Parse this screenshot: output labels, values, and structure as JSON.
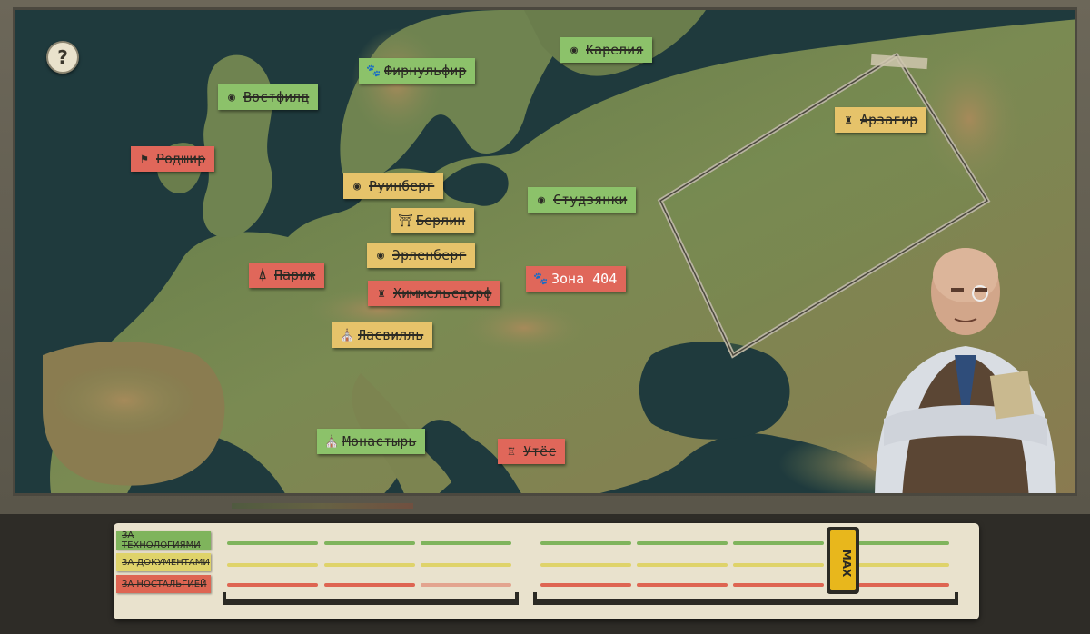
{
  "help_button": {
    "label": "?"
  },
  "cities": [
    {
      "name": "Карелия",
      "color": "green",
      "icon": "target-icon",
      "glyph": "◉",
      "crossed": true
    },
    {
      "name": "Фирнульфир",
      "color": "green",
      "icon": "paw-icon",
      "glyph": "🐾",
      "crossed": true
    },
    {
      "name": "Востфилд",
      "color": "green",
      "icon": "target-icon",
      "glyph": "◉",
      "crossed": true
    },
    {
      "name": "Арзагир",
      "color": "yellow",
      "icon": "castle-icon",
      "glyph": "♜",
      "crossed": true
    },
    {
      "name": "Родшир",
      "color": "red",
      "icon": "flag-icon",
      "glyph": "⚑",
      "crossed": true
    },
    {
      "name": "Руинберг",
      "color": "yellow",
      "icon": "target-icon",
      "glyph": "◉",
      "crossed": true
    },
    {
      "name": "Студзянки",
      "color": "green",
      "icon": "target-icon",
      "glyph": "◉",
      "crossed": true
    },
    {
      "name": "Берлин",
      "color": "yellow",
      "icon": "gate-icon",
      "glyph": "⛩",
      "crossed": true
    },
    {
      "name": "Эрленберг",
      "color": "yellow",
      "icon": "target-icon",
      "glyph": "◉",
      "crossed": true
    },
    {
      "name": "Париж",
      "color": "red",
      "icon": "eiffel-icon",
      "glyph": "⍋",
      "crossed": true
    },
    {
      "name": "Зона 404",
      "color": "red",
      "icon": "paw-icon",
      "glyph": "🐾",
      "crossed": false
    },
    {
      "name": "Химмельсдорф",
      "color": "red",
      "icon": "castle-icon",
      "glyph": "♜",
      "crossed": true
    },
    {
      "name": "Ласвилль",
      "color": "yellow",
      "icon": "chapel-icon",
      "glyph": "⛪",
      "crossed": true
    },
    {
      "name": "Монастырь",
      "color": "green",
      "icon": "church-icon",
      "glyph": "⛪",
      "crossed": true
    },
    {
      "name": "Утёс",
      "color": "red",
      "icon": "lighthouse-icon",
      "glyph": "♖",
      "crossed": true
    }
  ],
  "legend": [
    {
      "label": "ЗА ТЕХНОЛОГИЯМИ",
      "color": "#7fb45c"
    },
    {
      "label": "ЗА ДОКУМЕНТАМИ",
      "color": "#dfd36a"
    },
    {
      "label": "ЗА НОСТАЛЬГИЕЙ",
      "color": "#de6552"
    }
  ],
  "progress_marker": {
    "label": "MAX"
  },
  "colors": {
    "green": "#8cc26a",
    "yellow": "#e6c36a",
    "red": "#e0675a",
    "sea": "#1f3b3f",
    "land": "#5f7a46"
  }
}
